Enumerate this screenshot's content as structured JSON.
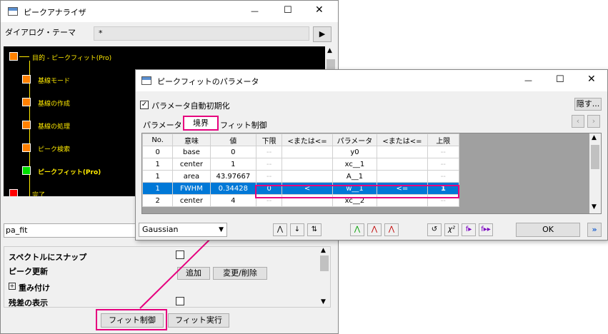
{
  "bg_window": {
    "title": "ピークアナライザ",
    "theme_label": "ダイアログ・テーマ",
    "theme_value": "*",
    "tree": [
      {
        "label": "目的 - ピークフィット(Pro)",
        "color": "#ff8000"
      },
      {
        "label": "基線モード",
        "color": "#ff8000"
      },
      {
        "label": "基線の作成",
        "color": "#ff8000"
      },
      {
        "label": "基線の処理",
        "color": "#ff8000"
      },
      {
        "label": "ピーク検索",
        "color": "#ff8000"
      },
      {
        "label": "ピークフィット(Pro)",
        "color": "#00ff00"
      },
      {
        "label": "完了",
        "color": "#ff0000"
      }
    ],
    "name_field": "pa_fit",
    "options": {
      "snap": "スペクトルにスナップ",
      "peak_update": "ピーク更新",
      "add": "追加",
      "change_delete": "変更/削除",
      "weights": "重み付け",
      "residual": "残差の表示"
    },
    "fit_control_button": "フィット制御",
    "fit_run_button": "フィット実行"
  },
  "dialog": {
    "title": "ピークフィットのパラメータ",
    "auto_init": "パラメータ自動初期化",
    "hide_button": "隠す...",
    "tabs": [
      "パラメータ",
      "境界",
      "フィット制御"
    ],
    "columns": [
      "No.",
      "意味",
      "値",
      "下限",
      "<または<=",
      "パラメータ",
      "<または<=",
      "上限"
    ],
    "rows": [
      [
        "0",
        "base",
        "0",
        "--",
        "",
        "y0",
        "",
        "--"
      ],
      [
        "1",
        "center",
        "1",
        "--",
        "",
        "xc__1",
        "",
        "--"
      ],
      [
        "1",
        "area",
        "43.97667",
        "--",
        "",
        "A__1",
        "",
        "--"
      ],
      [
        "1",
        "FWHM",
        "0.34428",
        "0",
        "<",
        "w__1",
        "<=",
        "1"
      ],
      [
        "2",
        "center",
        "4",
        "--",
        "",
        "xc__2",
        "",
        "--"
      ]
    ],
    "function": "Gaussian",
    "ok_button": "OK"
  },
  "colors": {
    "highlight": "#e6007e",
    "selection": "#0078d7"
  }
}
